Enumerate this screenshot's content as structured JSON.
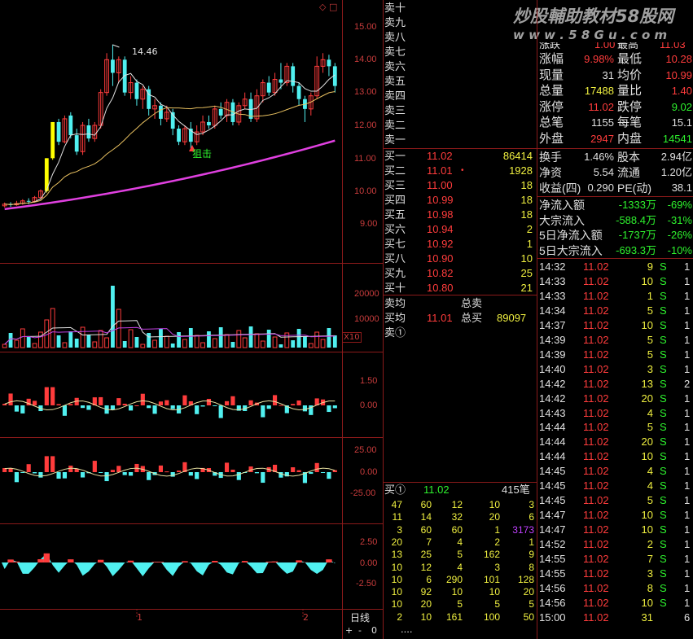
{
  "watermark": "炒股輔助教材58股网",
  "watermark_url": "w w w . 5 8 G u . c o m",
  "top_icon": "◇ □",
  "chart_annotations": {
    "high_label": "14.46",
    "signal_label": "狙击",
    "volume_unit": "X10",
    "period_label": "日线",
    "period_buttons": [
      "+",
      "-",
      "0"
    ],
    "x_ticks": [
      "1",
      "2"
    ]
  },
  "price_axis": [
    "15.00",
    "14.00",
    "13.00",
    "12.00",
    "11.00",
    "10.00",
    "9.00"
  ],
  "volume_axis": [
    "20000",
    "10000"
  ],
  "ind1_axis": [
    "1.50",
    "0.00"
  ],
  "ind2_axis": [
    "25.00",
    "0.00",
    "-25.00"
  ],
  "ind3_axis": [
    "2.50",
    "0.00",
    "-2.50"
  ],
  "sell_labels": [
    "卖十",
    "卖九",
    "卖八",
    "卖七",
    "卖六",
    "卖五",
    "卖四",
    "卖三",
    "卖二",
    "卖一"
  ],
  "buy_book": [
    {
      "label": "买一",
      "price": "11.02",
      "vol": "86414",
      "mark": ""
    },
    {
      "label": "买二",
      "price": "11.01",
      "vol": "1928",
      "mark": "•"
    },
    {
      "label": "买三",
      "price": "11.00",
      "vol": "18",
      "mark": ""
    },
    {
      "label": "买四",
      "price": "10.99",
      "vol": "18",
      "mark": ""
    },
    {
      "label": "买五",
      "price": "10.98",
      "vol": "18",
      "mark": ""
    },
    {
      "label": "买六",
      "price": "10.94",
      "vol": "2",
      "mark": ""
    },
    {
      "label": "买七",
      "price": "10.92",
      "vol": "1",
      "mark": ""
    },
    {
      "label": "买八",
      "price": "10.90",
      "vol": "10",
      "mark": ""
    },
    {
      "label": "买九",
      "price": "10.82",
      "vol": "25",
      "mark": ""
    },
    {
      "label": "买十",
      "price": "10.80",
      "vol": "21",
      "mark": ""
    }
  ],
  "avg": {
    "sell_avg_label": "卖均",
    "sell_total_label": "总卖",
    "buy_avg_label": "买均",
    "buy_avg": "11.01",
    "buy_total_label": "总买",
    "buy_total": "89097",
    "sell1_label": "卖①"
  },
  "queue": {
    "label": "买①",
    "price": "11.02",
    "count": "415笔",
    "rows": [
      [
        "47",
        "60",
        "12",
        "10",
        "3"
      ],
      [
        "11",
        "14",
        "32",
        "20",
        "6"
      ],
      [
        "3",
        "60",
        "60",
        "1",
        "3173"
      ],
      [
        "20",
        "7",
        "4",
        "2",
        "1"
      ],
      [
        "13",
        "25",
        "5",
        "162",
        "9"
      ],
      [
        "10",
        "12",
        "4",
        "3",
        "8"
      ],
      [
        "10",
        "6",
        "290",
        "101",
        "128"
      ],
      [
        "10",
        "92",
        "10",
        "10",
        "20"
      ],
      [
        "10",
        "20",
        "5",
        "5",
        "5"
      ],
      [
        "2",
        "10",
        "161",
        "100",
        "50"
      ]
    ],
    "more": "...."
  },
  "quote": {
    "partial_row": [
      "涨跌",
      "1.00",
      "最高",
      "11.03"
    ],
    "rows": [
      {
        "l1": "涨幅",
        "v1": "9.98%",
        "c1": "red",
        "l2": "最低",
        "v2": "10.28",
        "c2": "red"
      },
      {
        "l1": "现量",
        "v1": "31",
        "c1": "white",
        "l2": "均价",
        "v2": "10.99",
        "c2": "red"
      },
      {
        "l1": "总量",
        "v1": "17488",
        "c1": "yellow",
        "l2": "量比",
        "v2": "1.40",
        "c2": "red"
      },
      {
        "l1": "涨停",
        "v1": "11.02",
        "c1": "red",
        "l2": "跌停",
        "v2": "9.02",
        "c2": "green"
      },
      {
        "l1": "总笔",
        "v1": "1155",
        "c1": "white",
        "l2": "每笔",
        "v2": "15.1",
        "c2": "white"
      },
      {
        "l1": "外盘",
        "v1": "2947",
        "c1": "red",
        "l2": "内盘",
        "v2": "14541",
        "c2": "green"
      }
    ],
    "rows2": [
      {
        "l1": "换手",
        "v1": "1.46%",
        "l2": "股本",
        "v2": "2.94亿"
      },
      {
        "l1": "净资",
        "v1": "5.54",
        "l2": "流通",
        "v2": "1.20亿"
      },
      {
        "l1": "收益(四)",
        "v1": "0.290",
        "l2": "PE(动)",
        "v2": "38.1"
      }
    ],
    "flow": [
      {
        "label": "净流入额",
        "val": "-1333万",
        "pct": "-69%"
      },
      {
        "label": "大宗流入",
        "val": "-588.4万",
        "pct": "-31%"
      },
      {
        "label": "5日净流入额",
        "val": "-1737万",
        "pct": "-26%"
      },
      {
        "label": "5日大宗流入",
        "val": "-693.3万",
        "pct": "-10%"
      }
    ]
  },
  "ticks": [
    {
      "t": "14:32",
      "p": "11.02",
      "v": "9",
      "s": "S",
      "n": "1"
    },
    {
      "t": "14:33",
      "p": "11.02",
      "v": "10",
      "s": "S",
      "n": "1"
    },
    {
      "t": "14:33",
      "p": "11.02",
      "v": "1",
      "s": "S",
      "n": "1"
    },
    {
      "t": "14:34",
      "p": "11.02",
      "v": "5",
      "s": "S",
      "n": "1"
    },
    {
      "t": "14:37",
      "p": "11.02",
      "v": "10",
      "s": "S",
      "n": "1"
    },
    {
      "t": "14:39",
      "p": "11.02",
      "v": "5",
      "s": "S",
      "n": "1"
    },
    {
      "t": "14:39",
      "p": "11.02",
      "v": "5",
      "s": "S",
      "n": "1"
    },
    {
      "t": "14:40",
      "p": "11.02",
      "v": "3",
      "s": "S",
      "n": "1"
    },
    {
      "t": "14:42",
      "p": "11.02",
      "v": "13",
      "s": "S",
      "n": "2"
    },
    {
      "t": "14:42",
      "p": "11.02",
      "v": "20",
      "s": "S",
      "n": "1"
    },
    {
      "t": "14:43",
      "p": "11.02",
      "v": "4",
      "s": "S",
      "n": "1"
    },
    {
      "t": "14:44",
      "p": "11.02",
      "v": "5",
      "s": "S",
      "n": "1"
    },
    {
      "t": "14:44",
      "p": "11.02",
      "v": "20",
      "s": "S",
      "n": "1"
    },
    {
      "t": "14:44",
      "p": "11.02",
      "v": "10",
      "s": "S",
      "n": "1"
    },
    {
      "t": "14:45",
      "p": "11.02",
      "v": "4",
      "s": "S",
      "n": "1"
    },
    {
      "t": "14:45",
      "p": "11.02",
      "v": "4",
      "s": "S",
      "n": "1"
    },
    {
      "t": "14:45",
      "p": "11.02",
      "v": "5",
      "s": "S",
      "n": "1"
    },
    {
      "t": "14:47",
      "p": "11.02",
      "v": "10",
      "s": "S",
      "n": "1"
    },
    {
      "t": "14:47",
      "p": "11.02",
      "v": "10",
      "s": "S",
      "n": "1"
    },
    {
      "t": "14:52",
      "p": "11.02",
      "v": "2",
      "s": "S",
      "n": "1"
    },
    {
      "t": "14:55",
      "p": "11.02",
      "v": "7",
      "s": "S",
      "n": "1"
    },
    {
      "t": "14:55",
      "p": "11.02",
      "v": "3",
      "s": "S",
      "n": "1"
    },
    {
      "t": "14:56",
      "p": "11.02",
      "v": "8",
      "s": "S",
      "n": "1"
    },
    {
      "t": "14:56",
      "p": "11.02",
      "v": "10",
      "s": "S",
      "n": "1"
    },
    {
      "t": "15:00",
      "p": "11.02",
      "v": "31",
      "s": "",
      "n": "6"
    }
  ],
  "colors": {
    "up": "#ff3c3c",
    "down": "#50f0f0",
    "limit": "#ffff00",
    "ma_purple": "#e040e0",
    "grid": "#8b1a1a"
  }
}
